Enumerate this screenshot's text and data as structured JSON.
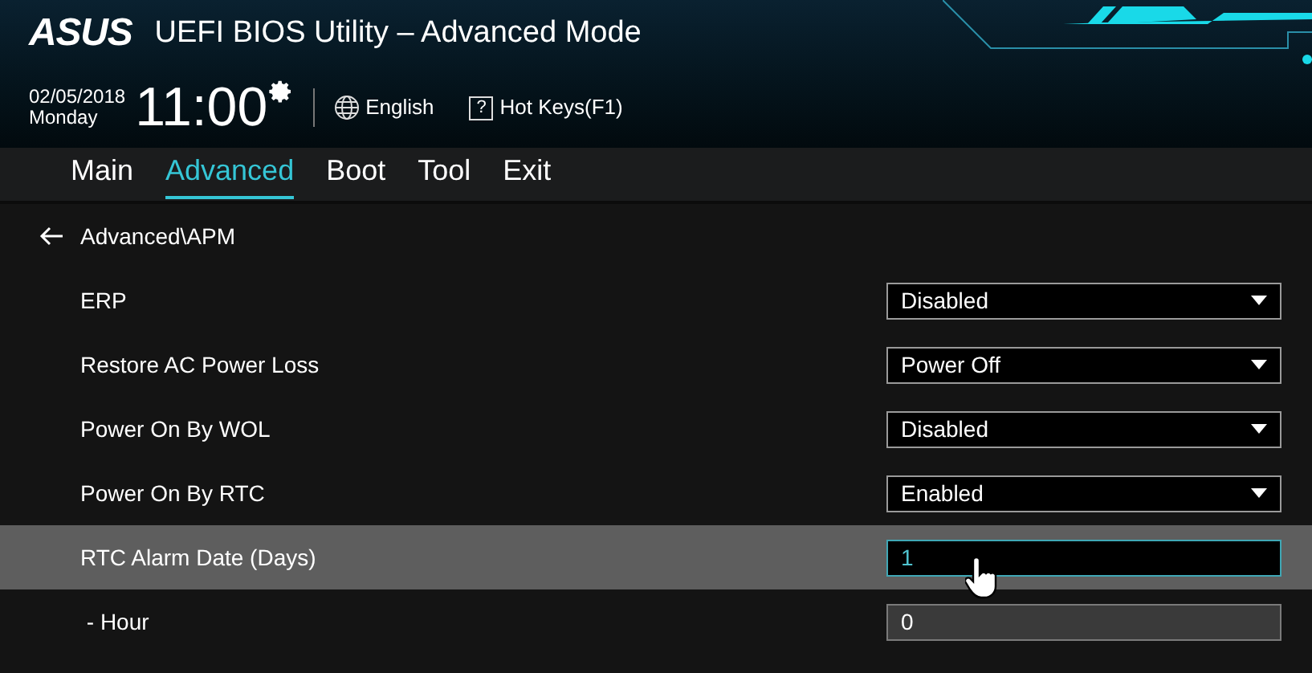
{
  "header": {
    "logo": "ASUS",
    "title": "UEFI BIOS Utility – Advanced Mode",
    "date": "02/05/2018",
    "day": "Monday",
    "time": "11:00",
    "language": "English",
    "hotkeys_icon": "?",
    "hotkeys": "Hot Keys(F1)"
  },
  "tabs": [
    {
      "label": "Main",
      "selected": false
    },
    {
      "label": "Advanced",
      "selected": true
    },
    {
      "label": "Boot",
      "selected": false
    },
    {
      "label": "Tool",
      "selected": false
    },
    {
      "label": "Exit",
      "selected": false
    }
  ],
  "breadcrumb": "Advanced\\APM",
  "settings": [
    {
      "label": "ERP",
      "kind": "dropdown",
      "value": "Disabled",
      "selected": false
    },
    {
      "label": "Restore AC Power Loss",
      "kind": "dropdown",
      "value": "Power Off",
      "selected": false
    },
    {
      "label": "Power On By WOL",
      "kind": "dropdown",
      "value": "Disabled",
      "selected": false
    },
    {
      "label": "Power On By RTC",
      "kind": "dropdown",
      "value": "Enabled",
      "selected": false
    },
    {
      "label": "RTC Alarm Date (Days)",
      "kind": "input",
      "value": "1",
      "selected": true
    },
    {
      "label": " - Hour",
      "kind": "input",
      "value": "0",
      "selected": false
    }
  ]
}
